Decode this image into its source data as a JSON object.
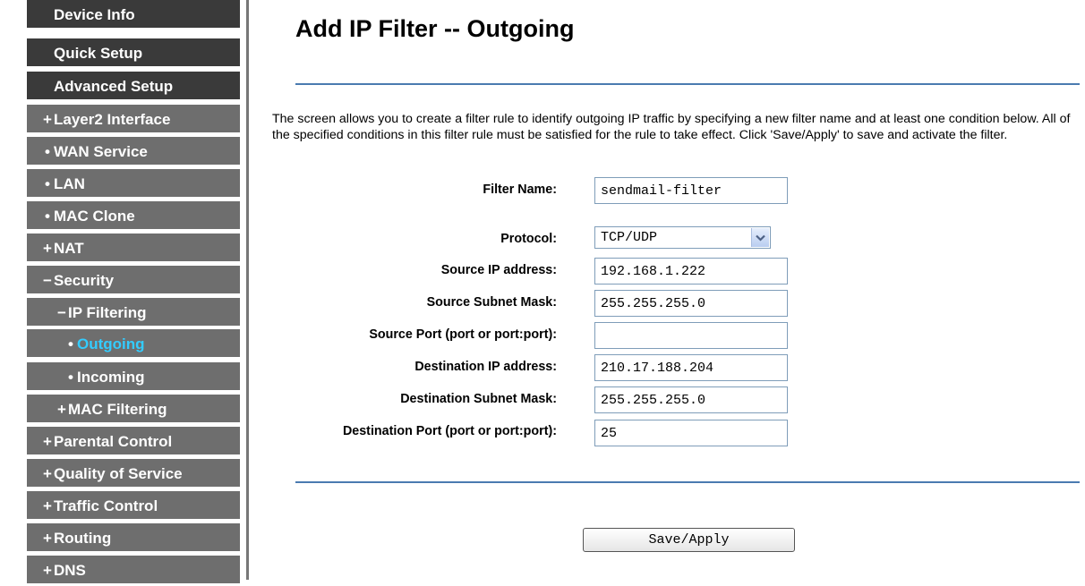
{
  "sidebar": {
    "items": [
      {
        "prefix": "",
        "label": "Device Info"
      },
      {
        "prefix": "",
        "label": "Quick Setup"
      },
      {
        "prefix": "",
        "label": "Advanced Setup"
      },
      {
        "prefix": "+",
        "label": "Layer2 Interface"
      },
      {
        "prefix": "•",
        "label": "WAN Service"
      },
      {
        "prefix": "•",
        "label": "LAN"
      },
      {
        "prefix": "•",
        "label": "MAC Clone"
      },
      {
        "prefix": "+",
        "label": "NAT"
      },
      {
        "prefix": "−",
        "label": "Security"
      },
      {
        "prefix": "−",
        "label": "IP Filtering"
      },
      {
        "prefix": "•",
        "label": "Outgoing"
      },
      {
        "prefix": "•",
        "label": "Incoming"
      },
      {
        "prefix": "+",
        "label": "MAC Filtering"
      },
      {
        "prefix": "+",
        "label": "Parental Control"
      },
      {
        "prefix": "+",
        "label": "Quality of Service"
      },
      {
        "prefix": "+",
        "label": "Traffic Control"
      },
      {
        "prefix": "+",
        "label": "Routing"
      },
      {
        "prefix": "+",
        "label": "DNS"
      }
    ]
  },
  "main": {
    "title": "Add IP Filter -- Outgoing",
    "description": "The screen allows you to create a filter rule to identify outgoing IP traffic by specifying a new filter name and at least one condition below. All of the specified conditions in this filter rule must be satisfied for the rule to take effect. Click 'Save/Apply' to save and activate the filter.",
    "form": {
      "filter_name": {
        "label": "Filter Name:",
        "value": "sendmail-filter"
      },
      "protocol": {
        "label": "Protocol:",
        "value": "TCP/UDP"
      },
      "source_ip": {
        "label": "Source IP address:",
        "value": "192.168.1.222"
      },
      "source_mask": {
        "label": "Source Subnet Mask:",
        "value": "255.255.255.0"
      },
      "source_port": {
        "label": "Source Port (port or port:port):",
        "value": ""
      },
      "dest_ip": {
        "label": "Destination IP address:",
        "value": "210.17.188.204"
      },
      "dest_mask": {
        "label": "Destination Subnet Mask:",
        "value": "255.255.255.0"
      },
      "dest_port": {
        "label": "Destination Port (port or port:port):",
        "value": "25"
      }
    },
    "save_button_label": "Save/Apply"
  },
  "colors": {
    "sidebar_top": "#3a3a3a",
    "sidebar_sub": "#6e6e6e",
    "active_link": "#33ccff",
    "rule": "#4a7bb0"
  },
  "icons": {
    "protocol_dropdown": "chevron-down-icon"
  }
}
